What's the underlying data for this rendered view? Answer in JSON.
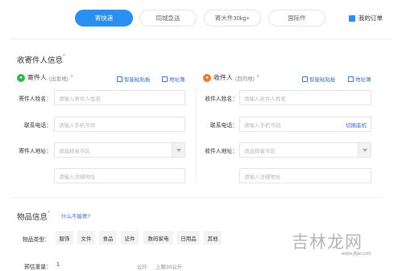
{
  "tabs": [
    {
      "label": "寄快递",
      "active": true
    },
    {
      "label": "同城急送",
      "active": false
    },
    {
      "label": "寄大件30kg+",
      "active": false
    },
    {
      "label": "国际件",
      "active": false
    }
  ],
  "my_order": "我的订单",
  "contact_section": {
    "title": "收寄件人信息",
    "required_mark": "*"
  },
  "sender": {
    "title": "寄件人",
    "subtitle": "(出发地)",
    "required_mark": "*",
    "smart_paste": "智能粘贴板",
    "address_book": "地址簿",
    "fields": {
      "name_label": "寄件人姓名：",
      "name_placeholder": "请输入寄件人姓名",
      "phone_label": "联系电话：",
      "phone_placeholder": "请输入手机号码",
      "address_label": "寄件人地址：",
      "region_placeholder": "请选择省市区",
      "detail_placeholder": "请输入详细地址"
    }
  },
  "receiver": {
    "title": "收件人",
    "subtitle": "(目的地)",
    "required_mark": "*",
    "smart_paste": "智能粘贴板",
    "address_book": "地址簿",
    "fields": {
      "name_label": "收件人姓名：",
      "name_placeholder": "请输入收件人姓名",
      "phone_label": "联系电话：",
      "phone_placeholder": "请输入手机号码",
      "switch_landline": "切换座机",
      "address_label": "收件人地址：",
      "region_placeholder": "请选择省市区",
      "detail_placeholder": "请输入详细地址"
    }
  },
  "goods_section": {
    "title": "物品信息",
    "required_mark": "*",
    "help_link": "什么不能寄?",
    "type_label": "物品类型：",
    "types": [
      "服饰",
      "文件",
      "食品",
      "证件",
      "数码家电",
      "日用品",
      "其他"
    ],
    "weight_label": "预估重量：",
    "weight_value": "1",
    "weight_unit": "公斤",
    "weight_limit": "上限30公斤"
  },
  "watermark": {
    "text": "吉林龙网",
    "url": "www.jlljw.com"
  },
  "colors": {
    "accent": "#2b8ff0",
    "link": "#3a6fcf",
    "sender_dot": "#38b24a",
    "receiver_dot": "#f07a2c"
  }
}
